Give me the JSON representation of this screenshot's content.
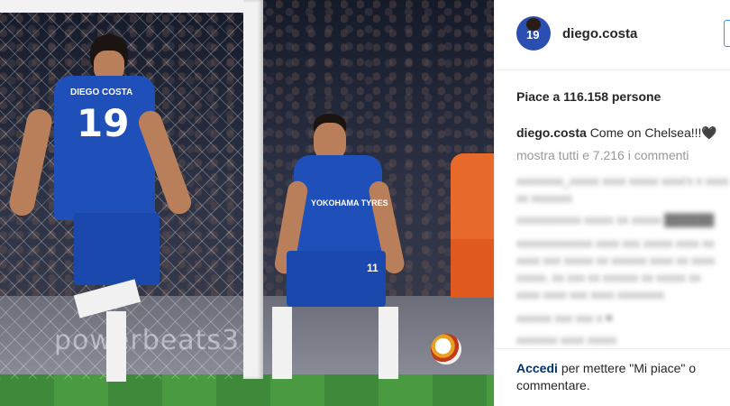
{
  "post": {
    "username": "diego.costa",
    "avatar_number": "19",
    "likes_text": "Piace a 116.158 persone",
    "caption_user": "diego.costa",
    "caption_text": "Come on Chelsea!!!🖤",
    "show_all_comments": "mostra tutti e 7.216 i commenti",
    "login_link": "Accedi",
    "login_rest": "per mettere \"Mi piace\" o commentare."
  },
  "photo": {
    "jersey_name": "DIEGO COSTA",
    "jersey_number": "19",
    "second_number": "11",
    "sponsor": "YOKOHAMA TYRES",
    "adboard": "powerbeats3"
  },
  "colors": {
    "link": "#003569",
    "primary_text": "#262626",
    "secondary_text": "#999999",
    "chelsea_blue": "#1f4fb8"
  }
}
